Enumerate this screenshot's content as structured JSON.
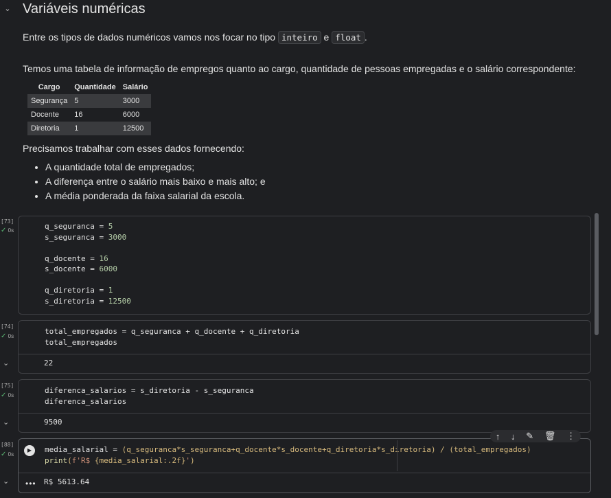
{
  "section": {
    "title": "Variáveis numéricas",
    "intro_prefix": "Entre os tipos de dados numéricos vamos nos focar no tipo ",
    "type_int": "inteiro",
    "intro_mid": " e ",
    "type_float": "float",
    "intro_suffix": ".",
    "table_intro": "Temos uma tabela de informação de empregos quanto ao cargo, quantidade de pessoas empregadas e o salário correspondente:",
    "table": {
      "headers": [
        "Cargo",
        "Quantidade",
        "Salário"
      ],
      "rows": [
        [
          "Segurança",
          "5",
          "3000"
        ],
        [
          "Docente",
          "16",
          "6000"
        ],
        [
          "Diretoria",
          "1",
          "12500"
        ]
      ]
    },
    "task_intro": "Precisamos trabalhar com esses dados fornecendo:",
    "bullets": [
      "A quantidade total de empregados;",
      "A diferença entre o salário mais baixo e mais alto; e",
      "A média ponderada da faixa salarial da escola."
    ]
  },
  "cells": [
    {
      "exec": "[73]",
      "time": "0s",
      "code": {
        "l1_var": "q_seguranca = ",
        "l1_num": "5",
        "l2_var": "s_seguranca = ",
        "l2_num": "3000",
        "l3_var": "q_docente = ",
        "l3_num": "16",
        "l4_var": "s_docente = ",
        "l4_num": "6000",
        "l5_var": "q_diretoria = ",
        "l5_num": "1",
        "l6_var": "s_diretoria = ",
        "l6_num": "12500"
      }
    },
    {
      "exec": "[74]",
      "time": "0s",
      "code_lines": [
        "total_empregados = q_seguranca + q_docente + q_diretoria",
        "total_empregados"
      ],
      "output": "22"
    },
    {
      "exec": "[75]",
      "time": "0s",
      "code_lines": [
        "diferenca_salarios = s_diretoria - s_seguranca",
        "diferenca_salarios"
      ],
      "output": "9500"
    },
    {
      "exec": "[88]",
      "time": "0s",
      "code": {
        "l1_a": "media_salarial = ",
        "l1_b": "(q_seguranca*s_seguranca+q_docente*s_docente+q_diretoria*s_diretoria) / (total_empregados)",
        "l2_fn": "print",
        "l2_open": "(",
        "l2_str_a": "f'R$ ",
        "l2_expr": "{media_salarial:.2f}",
        "l2_str_b": "'",
        "l2_close": ")"
      },
      "output": "R$ 5613.64"
    }
  ],
  "toolbar": {
    "up": "↑",
    "down": "↓",
    "edit": "✎",
    "delete": "🗑",
    "more": "⋮"
  },
  "output_menu": "•••"
}
